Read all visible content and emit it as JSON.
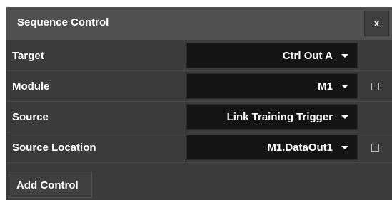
{
  "panel": {
    "title": "Sequence Control",
    "close_label": "x"
  },
  "rows": [
    {
      "label": "Target",
      "value": "Ctrl Out A",
      "has_checkbox": false,
      "checked": false
    },
    {
      "label": "Module",
      "value": "M1",
      "has_checkbox": true,
      "checked": false
    },
    {
      "label": "Source",
      "value": "Link Training Trigger",
      "has_checkbox": false,
      "checked": false
    },
    {
      "label": "Source Location",
      "value": "M1.DataOut1",
      "has_checkbox": true,
      "checked": false
    }
  ],
  "actions": {
    "add_control_label": "Add Control"
  },
  "colors": {
    "panel_bg": "#3b3b3b",
    "title_bar_bg": "#505050",
    "select_bg": "#141414",
    "text": "#ffffff"
  },
  "icons": {
    "dropdown": "chevron-down-icon",
    "close": "close-icon"
  }
}
